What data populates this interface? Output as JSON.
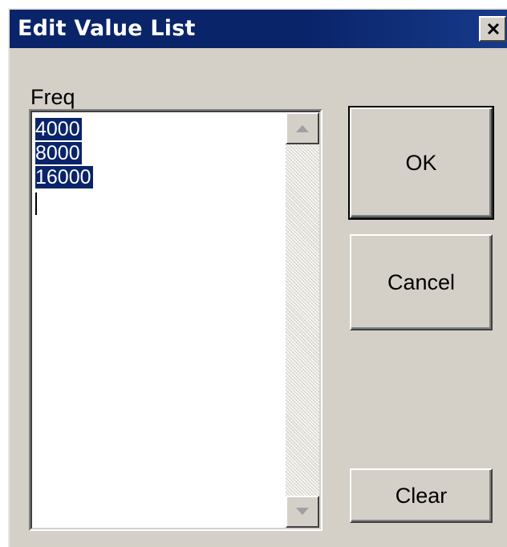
{
  "window": {
    "title": "Edit Value List",
    "close_icon": "close-icon"
  },
  "field": {
    "label": "Freq",
    "values": [
      "4000",
      "8000",
      "16000"
    ]
  },
  "buttons": {
    "ok_label": "OK",
    "cancel_label": "Cancel",
    "clear_label": "Clear"
  },
  "colors": {
    "titlebar": "#0a246a",
    "face": "#d4d0c8",
    "selection": "#0a246a"
  }
}
